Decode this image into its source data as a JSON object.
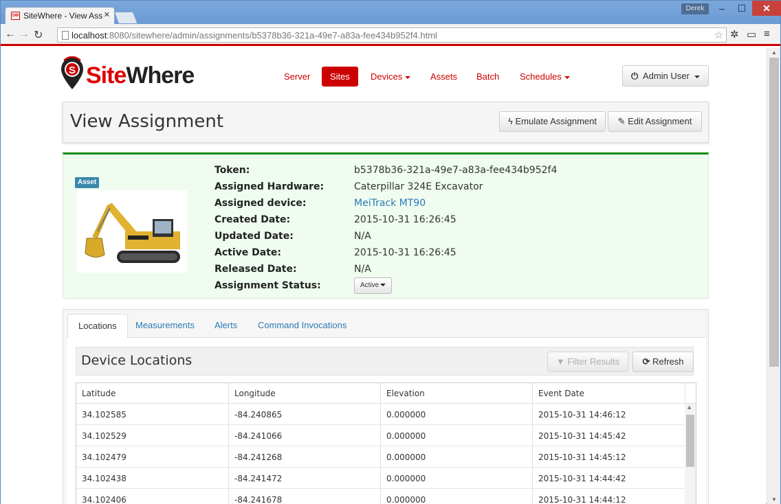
{
  "browser": {
    "tab_title": "SiteWhere - View Ass",
    "favicon_text": "SW",
    "user_badge": "Derek",
    "url_host": "localhost",
    "url_rest": ":8080/sitewhere/admin/assignments/b5378b36-321a-49e7-a83a-fee434b952f4.html"
  },
  "logo": {
    "site": "Site",
    "where": "Where"
  },
  "nav": {
    "items": [
      {
        "label": "Server"
      },
      {
        "label": "Sites"
      },
      {
        "label": "Devices"
      },
      {
        "label": "Assets"
      },
      {
        "label": "Batch"
      },
      {
        "label": "Schedules"
      }
    ],
    "active": "Sites",
    "user_label": "Admin User"
  },
  "header": {
    "title": "View Assignment",
    "emulate_label": "Emulate Assignment",
    "edit_label": "Edit Assignment"
  },
  "assignment": {
    "badge": "Asset",
    "fields": [
      {
        "label": "Token:",
        "value": "b5378b36-321a-49e7-a83a-fee434b952f4"
      },
      {
        "label": "Assigned Hardware:",
        "value": "Caterpillar 324E Excavator"
      },
      {
        "label": "Assigned device:",
        "value": "MeiTrack MT90"
      },
      {
        "label": "Created Date:",
        "value": "2015-10-31 16:26:45"
      },
      {
        "label": "Updated Date:",
        "value": "N/A"
      },
      {
        "label": "Active Date:",
        "value": "2015-10-31 16:26:45"
      },
      {
        "label": "Released Date:",
        "value": "N/A"
      },
      {
        "label": "Assignment Status:",
        "value": "Active"
      }
    ]
  },
  "tabs": {
    "items": [
      {
        "label": "Locations"
      },
      {
        "label": "Measurements"
      },
      {
        "label": "Alerts"
      },
      {
        "label": "Command Invocations"
      }
    ],
    "active": "Locations"
  },
  "locations": {
    "title": "Device Locations",
    "filter_label": "Filter Results",
    "refresh_label": "Refresh",
    "columns": [
      "Latitude",
      "Longitude",
      "Elevation",
      "Event Date"
    ],
    "rows": [
      [
        "34.102585",
        "-84.240865",
        "0.000000",
        "2015-10-31 14:46:12"
      ],
      [
        "34.102529",
        "-84.241066",
        "0.000000",
        "2015-10-31 14:45:42"
      ],
      [
        "34.102479",
        "-84.241268",
        "0.000000",
        "2015-10-31 14:45:12"
      ],
      [
        "34.102438",
        "-84.241472",
        "0.000000",
        "2015-10-31 14:44:42"
      ],
      [
        "34.102406",
        "-84.241678",
        "0.000000",
        "2015-10-31 14:44:12"
      ]
    ]
  },
  "colors": {
    "brand": "#cc0000",
    "link": "#2a7ab8",
    "success_border": "#0a8a0a",
    "success_bg": "#effcef"
  }
}
